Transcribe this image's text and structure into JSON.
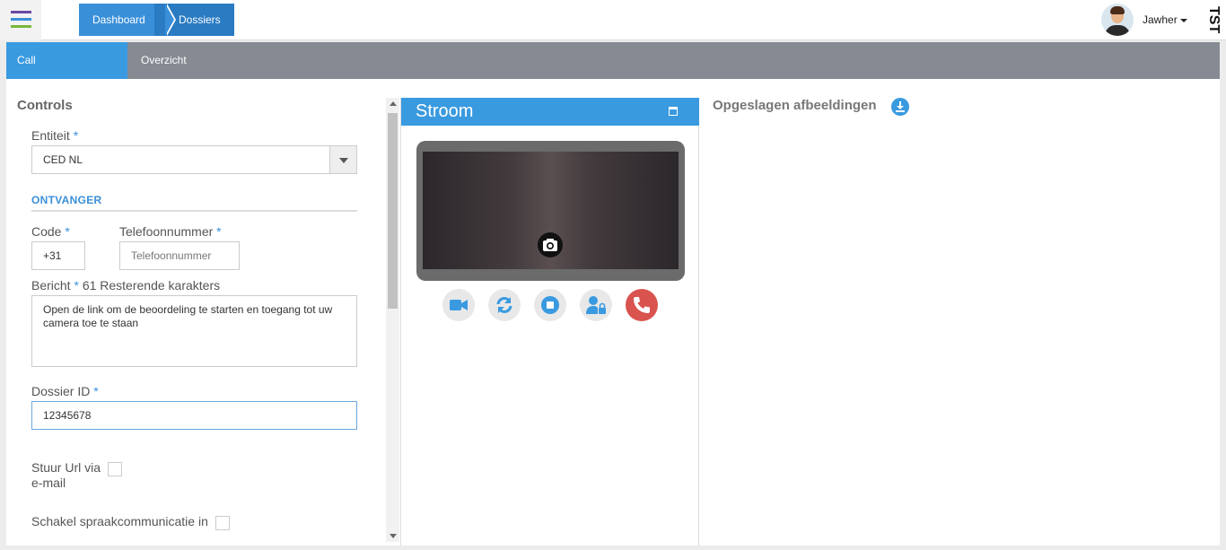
{
  "header": {
    "breadcrumbs": [
      "Dashboard",
      "Dossiers"
    ],
    "user_name": "Jawher",
    "env_label": "TST"
  },
  "tabs": [
    "Call",
    "Overzicht"
  ],
  "controls": {
    "title": "Controls",
    "entity_label": "Entiteit",
    "entity_value": "CED NL",
    "receiver_heading": "ONTVANGER",
    "code_label": "Code",
    "code_value": "+31",
    "phone_label": "Telefoonnummer",
    "phone_placeholder": "Telefoonnummer",
    "message_label": "Bericht",
    "message_remaining": "61 Resterende karakters",
    "message_value": "Open de link om de beoordeling te starten en toegang tot uw camera toe te staan",
    "dossier_label": "Dossier ID",
    "dossier_value": "12345678",
    "email_label_1": "Stuur Url via",
    "email_label_2": "e-mail",
    "voice_label": "Schakel spraakcommunicatie in",
    "required_mark": "*"
  },
  "stream": {
    "title": "Stroom",
    "buttons": [
      "video-icon",
      "refresh-icon",
      "stop-icon",
      "user-lock-icon",
      "phone-icon"
    ]
  },
  "images": {
    "title": "Opgeslagen afbeeldingen"
  },
  "colors": {
    "accent": "#3a9ae0",
    "hangup": "#d9534f",
    "tabbar": "#868a92"
  }
}
